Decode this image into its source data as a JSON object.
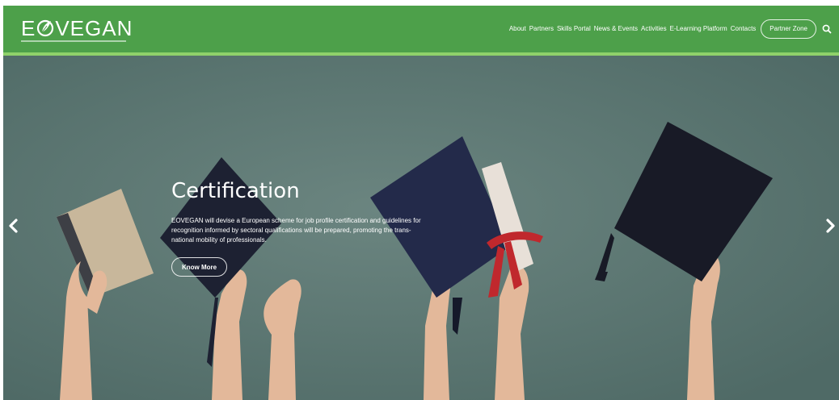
{
  "brand": {
    "logo_text_left": "E",
    "logo_text_right": "VEGAN"
  },
  "nav": {
    "items": [
      {
        "label": "About"
      },
      {
        "label": "Partners"
      },
      {
        "label": "Skills Portal"
      },
      {
        "label": "News & Events"
      },
      {
        "label": "Activities"
      },
      {
        "label": "E-Learning Platform"
      },
      {
        "label": "Contacts"
      }
    ],
    "partner_zone": "Partner Zone",
    "search_icon": "search-icon"
  },
  "hero": {
    "title": "Certification",
    "description": "EOVEGAN will devise a European scheme for job profile certification and guidelines for recognition informed by sectoral qualifications will be prepared, promoting the trans-national mobility of professionals.",
    "cta": "Know More",
    "prev_icon": "chevron-left-icon",
    "next_icon": "chevron-right-icon"
  },
  "colors": {
    "header_green": "#4da04a",
    "header_accent": "#8fd16a",
    "hero_background": "#5a7470"
  }
}
